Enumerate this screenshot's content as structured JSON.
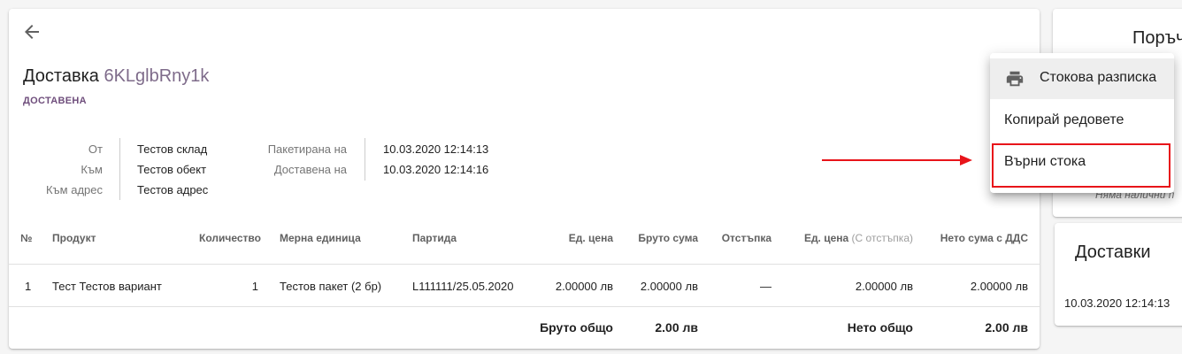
{
  "page": {
    "title_prefix": "Доставка",
    "title_code": "6KLglbRny1k",
    "status": "ДОСТАВЕНА"
  },
  "info": {
    "from_label": "От",
    "from_value": "Тестов склад",
    "to_label": "Към",
    "to_value": "Тестов обект",
    "address_label": "Към адрес",
    "address_value": "Тестов адрес",
    "packed_label": "Пакетирана на",
    "packed_value": "10.03.2020 12:14:13",
    "delivered_label": "Доставена на",
    "delivered_value": "10.03.2020 12:14:16"
  },
  "table": {
    "headers": {
      "no": "№",
      "product": "Продукт",
      "qty": "Количество",
      "unit": "Мерна единица",
      "batch": "Партида",
      "unit_price": "Ед. цена",
      "gross": "Бруто сума",
      "discount": "Отстъпка",
      "unit_price_disc": "Ед. цена",
      "unit_price_disc_sub": "(С отстъпка)",
      "net_vat": "Нето сума с ДДС"
    },
    "rows": [
      {
        "no": "1",
        "product": "Тест Тестов вариант",
        "qty": "1",
        "unit": "Тестов пакет (2 бр)",
        "batch": "L111111/25.05.2020",
        "unit_price": "2.00000 лв",
        "gross": "2.00000 лв",
        "discount": "—",
        "unit_price_disc": "2.00000 лв",
        "net_vat": "2.00000 лв"
      }
    ],
    "totals": {
      "gross_label": "Бруто общо",
      "gross_value": "2.00 лв",
      "net_label": "Нето общо",
      "net_value": "2.00 лв"
    }
  },
  "side": {
    "orders_title": "Поръч",
    "empty_text": "Няма налични п",
    "deliveries_title": "Доставки",
    "delivery_date": "10.03.2020 12:14:13"
  },
  "menu": {
    "print_label": "Стокова разписка",
    "copy_label": "Копирай редовете",
    "return_label": "Върни стока"
  },
  "colors": {
    "accent": "#6f4e7c",
    "annotation": "#e8141a"
  }
}
